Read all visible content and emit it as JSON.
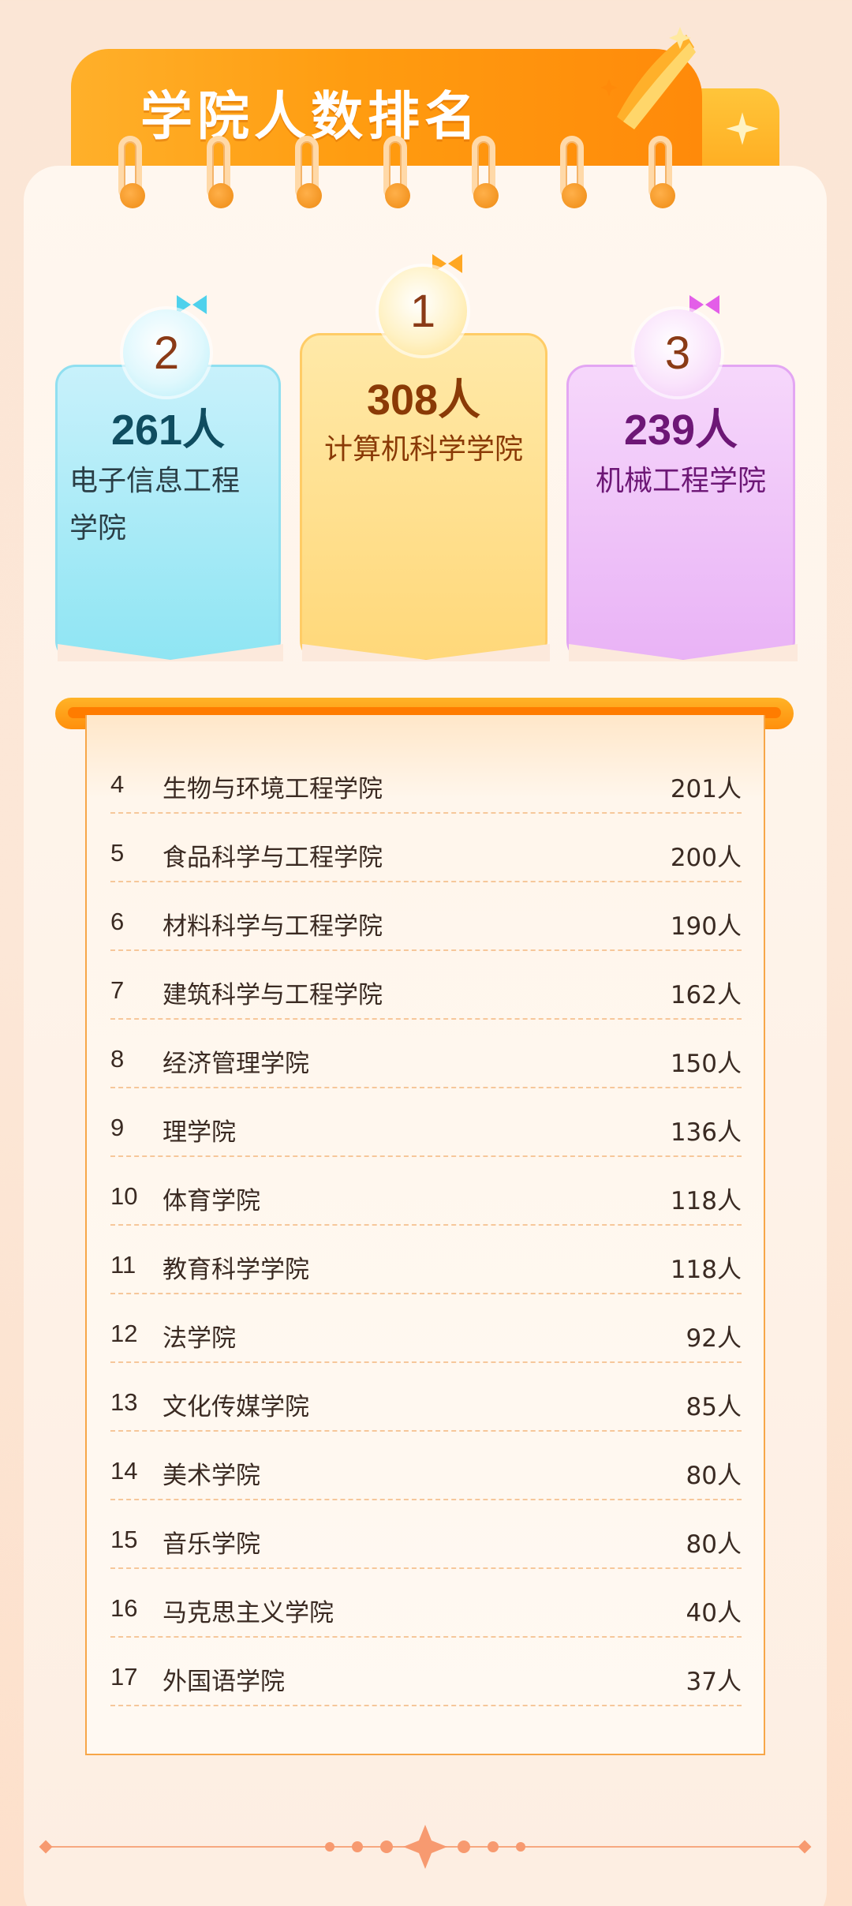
{
  "title": "学院人数排名",
  "podium": [
    {
      "rank": "2",
      "count": "261人",
      "name_line1": "电子信息工程",
      "name_line2": "学院",
      "accent": "#0f4d60"
    },
    {
      "rank": "1",
      "count": "308人",
      "name": "计算机科学学院",
      "accent": "#8a3a06"
    },
    {
      "rank": "3",
      "count": "239人",
      "name": "机械工程学院",
      "accent": "#6d1776"
    }
  ],
  "list": [
    {
      "rank": "4",
      "name": "生物与环境工程学院",
      "count": "201人"
    },
    {
      "rank": "5",
      "name": "食品科学与工程学院",
      "count": "200人"
    },
    {
      "rank": "6",
      "name": "材料科学与工程学院",
      "count": "190人"
    },
    {
      "rank": "7",
      "name": "建筑科学与工程学院",
      "count": "162人"
    },
    {
      "rank": "8",
      "name": "经济管理学院",
      "count": "150人"
    },
    {
      "rank": "9",
      "name": "理学院",
      "count": "136人"
    },
    {
      "rank": "10",
      "name": "体育学院",
      "count": "118人"
    },
    {
      "rank": "11",
      "name": "教育科学学院",
      "count": "118人"
    },
    {
      "rank": "12",
      "name": "法学院",
      "count": "92人"
    },
    {
      "rank": "13",
      "name": "文化传媒学院",
      "count": "85人"
    },
    {
      "rank": "14",
      "name": "美术学院",
      "count": "80人"
    },
    {
      "rank": "15",
      "name": "音乐学院",
      "count": "80人"
    },
    {
      "rank": "16",
      "name": "马克思主义学院",
      "count": "40人"
    },
    {
      "rank": "17",
      "name": "外国语学院",
      "count": "37人"
    }
  ],
  "colors": {
    "orange": "#ff9c10",
    "gold_card": "#ffd87a",
    "cyan_card": "#8fe5f3",
    "purple_card": "#e9b3f6",
    "text": "#3a2a22"
  },
  "icons": [
    "sparkle-icon",
    "ribbon-icon",
    "binder-ring-icon",
    "bow-icon",
    "diamond-star-icon"
  ]
}
